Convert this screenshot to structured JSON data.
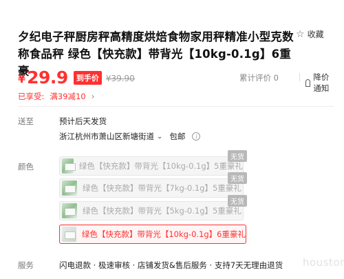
{
  "product": {
    "title": "夕纪电子秤厨房秤高精度烘焙食物家用秤精准小型克数称食品秤 绿色【快充款】带背光【10kg-0.1g】6重豪",
    "favorite_label": "收藏"
  },
  "price": {
    "currency": "¥",
    "amount": "29.9",
    "badge": "到手价",
    "original": "¥39.90",
    "rating": "累计评价 0",
    "price_alert": "降价通知"
  },
  "promo": {
    "label": "已享受:",
    "value": "满39减10"
  },
  "shipping": {
    "label": "送至",
    "eta": "预计后天发货",
    "address": "浙江杭州市萧山区新塘街道",
    "fee": "包邮"
  },
  "color": {
    "label": "颜色",
    "options": [
      {
        "text": "绿色【快充款】带背光【10kg-0.1g】5重豪礼",
        "tag": "无货",
        "selected": false
      },
      {
        "text": "绿色【快充款】带背光【7kg-0.1g】5重豪礼",
        "tag": "无货",
        "selected": false
      },
      {
        "text": "绿色【快充款】带背光【5kg-0.1g】5重豪礼",
        "tag": "无货",
        "selected": false
      },
      {
        "text": "绿色【快充款】带背光【10kg-0.1g】6重豪礼",
        "tag": "",
        "selected": true
      }
    ]
  },
  "service": {
    "label": "服务",
    "text": "闪电退款 · 极速审核 · 店铺发货&售后服务 · 支持7天无理由退货"
  },
  "watermark": "houston",
  "colors": {
    "accent": "#ff3030",
    "muted": "#999999",
    "sold_out_tag": "#b8b8b8"
  },
  "icons": {
    "favorite": "star-outline-icon",
    "alert": "bell-icon",
    "info": "info-circle-icon",
    "caret": "chevron-down-icon",
    "more": "chevron-right-icon"
  }
}
